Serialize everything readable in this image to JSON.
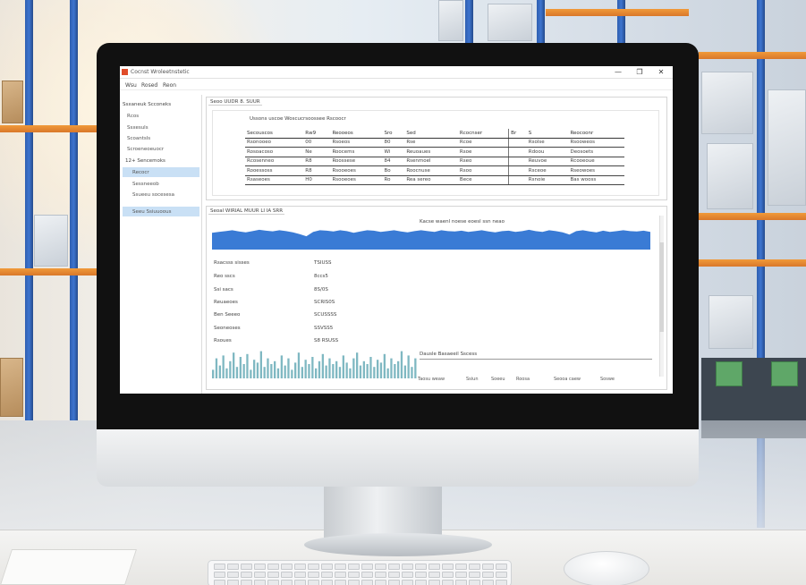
{
  "window": {
    "title": "Cocnst Wroleetnstetic",
    "controls": [
      "—",
      "❐",
      "✕"
    ]
  },
  "menu": [
    "Wsu",
    "Rosed",
    "Reon"
  ],
  "sidebar": {
    "sections": [
      {
        "label": "Ssxaneuk Scconeks",
        "items": [
          "Rcos",
          "Ssxesuls",
          "Scoantsls",
          "Scroeneoeuocr"
        ]
      },
      {
        "label": "12+ Sencemoks",
        "items": [
          "Recocr",
          "Sessneeob",
          "Ssueeu socesesa",
          "Seeu Ssiuuoous"
        ]
      }
    ]
  },
  "table_panel": {
    "title": "Seoo UUDR 8. SUUR",
    "caption": "Ussons uscoe Woscucrsoossee Rscoocr",
    "columns": [
      "Secouscos",
      "Rw9",
      "Reooeos",
      "Sro",
      "Sed",
      "Rcocnser",
      "Br",
      "S",
      "Reocoonr"
    ],
    "rows": [
      [
        "Rsonooeo",
        "00",
        "Rsoeos",
        "80",
        "Rse",
        "Rcoe",
        "",
        "Rsolse",
        "Rsooweos"
      ],
      [
        "Rosoacoso",
        "Ne",
        "Roocems",
        "Wi",
        "Reuoaues",
        "Rsoe",
        "",
        "Rdoou",
        "Deosoets"
      ],
      [
        "Rcosenneo",
        "R8",
        "Roossese",
        "84",
        "Rsenmoel",
        "Rseo",
        "",
        "Reuvoe",
        "Rcooeoue"
      ],
      [
        "Rooessoss",
        "R8",
        "Rsooeoes",
        "Bo",
        "Roocnuse",
        "Rsoo",
        "",
        "Rsceoe",
        "Rseowoes"
      ],
      [
        "Rsaseoes",
        "H0",
        "Rsooeoes",
        "Ro",
        "Rea sereo",
        "Bece",
        "",
        "Rsnoie",
        "Bas wooss"
      ]
    ]
  },
  "chart_panel": {
    "title": "Seoal WIRIAL MUUR LI IA SRR",
    "caption": "Kacse waenl noese  eoesl ssn neao",
    "stats": [
      {
        "label": "Rsacsss sisses",
        "value": "TSIUSS"
      },
      {
        "label": "Reo sscs",
        "value": "8ccs5"
      },
      {
        "label": "Ssi sacs",
        "value": "8S/0S"
      },
      {
        "label": "Reuaeoes",
        "value": "SCRIS0S"
      },
      {
        "label": "Ben Seeeo",
        "value": "SCUSSSS"
      },
      {
        "label": "Seoneoses",
        "value": "SSVSS5"
      },
      {
        "label": "Rsoues",
        "value": "S8 RSUSS"
      }
    ],
    "legend_caption": "Dausle  Basaeeil Sscess",
    "footer": [
      "Taosu weaw",
      "Ssiun",
      "Soeeu",
      "Roosa",
      "Seooa caew",
      "Soswe"
    ],
    "colors": {
      "area": "#3a7bd5",
      "mini": "#7fb8c2"
    }
  },
  "chart_data": [
    {
      "type": "area",
      "values": [
        0.78,
        0.82,
        0.86,
        0.9,
        0.84,
        0.8,
        0.86,
        0.92,
        0.88,
        0.85,
        0.9,
        0.86,
        0.8,
        0.72,
        0.62,
        0.82,
        0.9,
        0.88,
        0.84,
        0.9,
        0.86,
        0.78,
        0.84,
        0.9,
        0.88,
        0.82,
        0.86,
        0.9,
        0.84,
        0.8,
        0.86,
        0.9,
        0.86,
        0.82,
        0.9,
        0.86,
        0.84,
        0.88,
        0.82,
        0.86,
        0.9,
        0.84,
        0.8,
        0.86,
        0.88,
        0.82,
        0.86,
        0.92,
        0.86,
        0.82,
        0.9,
        0.86,
        0.8,
        0.7,
        0.86,
        0.9,
        0.84,
        0.8,
        0.88,
        0.82,
        0.86,
        0.9,
        0.86,
        0.84,
        0.88,
        0.82
      ]
    },
    {
      "type": "bar",
      "values": [
        0.3,
        0.7,
        0.45,
        0.8,
        0.35,
        0.6,
        0.9,
        0.4,
        0.75,
        0.5,
        0.85,
        0.3,
        0.65,
        0.55,
        0.95,
        0.4,
        0.7,
        0.5,
        0.6,
        0.35,
        0.8,
        0.45,
        0.7,
        0.3,
        0.55,
        0.9,
        0.4,
        0.65,
        0.5,
        0.75,
        0.35,
        0.6,
        0.85,
        0.45,
        0.7,
        0.5,
        0.6,
        0.4,
        0.8,
        0.55,
        0.35,
        0.7,
        0.9,
        0.45,
        0.6,
        0.5,
        0.75,
        0.4,
        0.65,
        0.55,
        0.85,
        0.35,
        0.7,
        0.5,
        0.6,
        0.95,
        0.45,
        0.8,
        0.4,
        0.7
      ]
    }
  ]
}
